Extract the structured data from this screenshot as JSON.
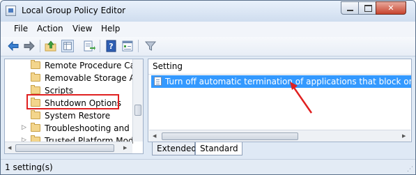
{
  "window": {
    "title": "Local Group Policy Editor"
  },
  "menu": {
    "items": [
      "File",
      "Action",
      "View",
      "Help"
    ]
  },
  "toolbar": {
    "icons": [
      "back-icon",
      "forward-icon",
      "up-folder-icon",
      "show-hide-tree-icon",
      "export-list-icon",
      "help-icon",
      "properties-icon",
      "filter-icon"
    ]
  },
  "tree": {
    "items": [
      {
        "label": "Remote Procedure Call",
        "expandable": false
      },
      {
        "label": "Removable Storage Acc",
        "expandable": false
      },
      {
        "label": "Scripts",
        "expandable": false
      },
      {
        "label": "Shutdown Options",
        "expandable": false,
        "highlighted": true
      },
      {
        "label": "System Restore",
        "expandable": false
      },
      {
        "label": "Troubleshooting and Di",
        "expandable": true
      },
      {
        "label": "Trusted Platform Modu",
        "expandable": true
      }
    ]
  },
  "list": {
    "column_header": "Setting",
    "rows": [
      {
        "label": "Turn off automatic termination of applications that block or...",
        "selected": true
      }
    ]
  },
  "tabs": {
    "extended": "Extended",
    "standard": "Standard",
    "active": "Standard"
  },
  "status": {
    "text": "1 setting(s)"
  },
  "colors": {
    "selection": "#3399ff",
    "annotation": "#e02020"
  }
}
